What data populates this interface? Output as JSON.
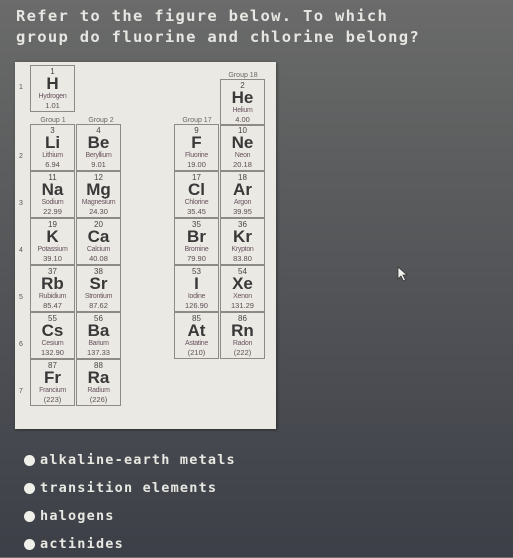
{
  "question": {
    "line1": "Refer to the figure below. To which",
    "line2": "group do fluorine and chlorine belong?"
  },
  "figure": {
    "period_labels": [
      "1",
      "2",
      "3",
      "4",
      "5",
      "6",
      "7"
    ],
    "group_labels": {
      "group1": "Group 1",
      "group2": "Group 2",
      "group17": "Group 17",
      "group18": "Group 18"
    },
    "elements": {
      "H": {
        "number": "1",
        "symbol": "H",
        "name": "Hydrogen",
        "mass": "1.01"
      },
      "Li": {
        "number": "3",
        "symbol": "Li",
        "name": "Lithium",
        "mass": "6.94"
      },
      "Be": {
        "number": "4",
        "symbol": "Be",
        "name": "Beryllium",
        "mass": "9.01"
      },
      "Na": {
        "number": "11",
        "symbol": "Na",
        "name": "Sodium",
        "mass": "22.99"
      },
      "Mg": {
        "number": "12",
        "symbol": "Mg",
        "name": "Magnesium",
        "mass": "24.30"
      },
      "K": {
        "number": "19",
        "symbol": "K",
        "name": "Potassium",
        "mass": "39.10"
      },
      "Ca": {
        "number": "20",
        "symbol": "Ca",
        "name": "Calcium",
        "mass": "40.08"
      },
      "Rb": {
        "number": "37",
        "symbol": "Rb",
        "name": "Rubidium",
        "mass": "85.47"
      },
      "Sr": {
        "number": "38",
        "symbol": "Sr",
        "name": "Strontium",
        "mass": "87.62"
      },
      "Cs": {
        "number": "55",
        "symbol": "Cs",
        "name": "Cesium",
        "mass": "132.90"
      },
      "Ba": {
        "number": "56",
        "symbol": "Ba",
        "name": "Barium",
        "mass": "137.33"
      },
      "Fr": {
        "number": "87",
        "symbol": "Fr",
        "name": "Francium",
        "mass": "(223)"
      },
      "Ra": {
        "number": "88",
        "symbol": "Ra",
        "name": "Radium",
        "mass": "(226)"
      },
      "He": {
        "number": "2",
        "symbol": "He",
        "name": "Helium",
        "mass": "4.00"
      },
      "F": {
        "number": "9",
        "symbol": "F",
        "name": "Fluorine",
        "mass": "19.00"
      },
      "Ne": {
        "number": "10",
        "symbol": "Ne",
        "name": "Neon",
        "mass": "20.18"
      },
      "Cl": {
        "number": "17",
        "symbol": "Cl",
        "name": "Chlorine",
        "mass": "35.45"
      },
      "Ar": {
        "number": "18",
        "symbol": "Ar",
        "name": "Argon",
        "mass": "39.95"
      },
      "Br": {
        "number": "35",
        "symbol": "Br",
        "name": "Bromine",
        "mass": "79.90"
      },
      "Kr": {
        "number": "36",
        "symbol": "Kr",
        "name": "Krypton",
        "mass": "83.80"
      },
      "I": {
        "number": "53",
        "symbol": "I",
        "name": "Iodine",
        "mass": "126.90"
      },
      "Xe": {
        "number": "54",
        "symbol": "Xe",
        "name": "Xenon",
        "mass": "131.29"
      },
      "At": {
        "number": "85",
        "symbol": "At",
        "name": "Astatine",
        "mass": "(210)"
      },
      "Rn": {
        "number": "86",
        "symbol": "Rn",
        "name": "Radon",
        "mass": "(222)"
      }
    }
  },
  "options": [
    {
      "label": "alkaline-earth metals"
    },
    {
      "label": "transition elements"
    },
    {
      "label": "halogens"
    },
    {
      "label": "actinides"
    }
  ]
}
